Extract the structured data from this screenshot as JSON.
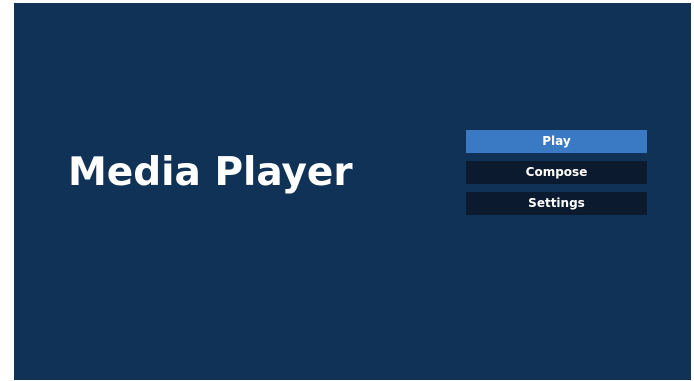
{
  "app": {
    "title": "Media Player"
  },
  "menu": {
    "items": [
      {
        "label": "Play",
        "state": "selected"
      },
      {
        "label": "Compose",
        "state": "normal"
      },
      {
        "label": "Settings",
        "state": "normal"
      }
    ]
  },
  "colors": {
    "background": "#103257",
    "selected_button": "#3a79c4",
    "button": "#0b1a2e",
    "text": "#ffffff"
  }
}
